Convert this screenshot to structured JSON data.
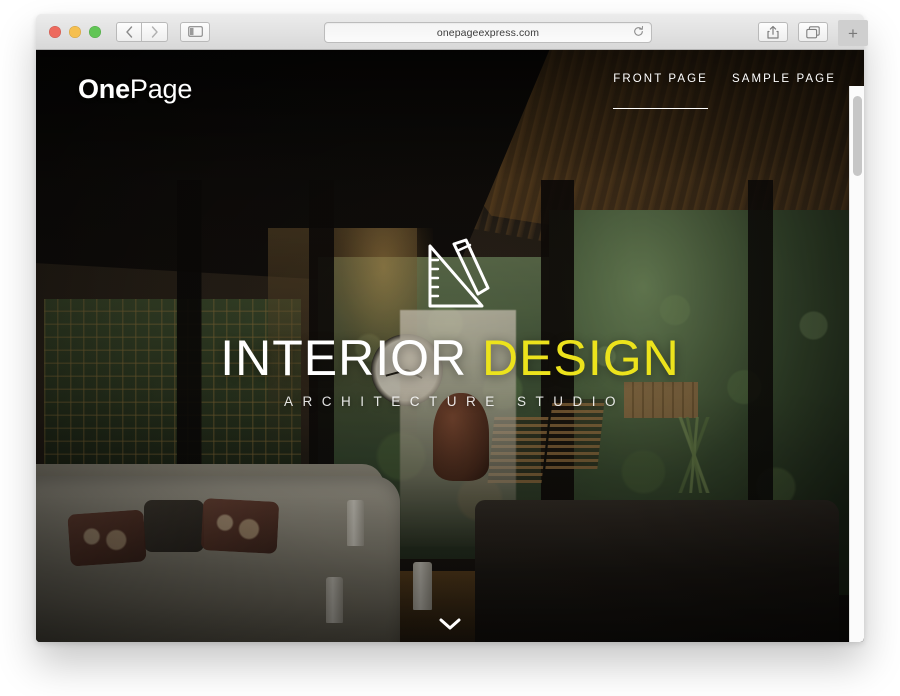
{
  "browser": {
    "traffic_lights": [
      {
        "name": "close",
        "color": "#ED6A5E"
      },
      {
        "name": "minimize",
        "color": "#F5BF4F"
      },
      {
        "name": "zoom",
        "color": "#61C555"
      }
    ],
    "back_label": "‹",
    "forward_label": "›",
    "sidebar_label": "sidebar-toggle",
    "url": "onepageexpress.com",
    "reload_label": "reload",
    "share_label": "share",
    "tabs_label": "show-all-tabs",
    "new_tab_label": "+"
  },
  "site": {
    "logo": {
      "bold_part": "One",
      "light_part": "Page"
    },
    "nav": [
      {
        "label": "FRONT PAGE",
        "active": true
      },
      {
        "label": "SAMPLE PAGE",
        "active": false
      }
    ],
    "hero": {
      "icon_name": "set-square-and-pencil-icon",
      "title_white": "INTERIOR",
      "title_yellow": "DESIGN",
      "subtitle": "ARCHITECTURE STUDIO",
      "scroll_cue_name": "chevron-down-icon",
      "accent_color": "#ECE31C",
      "text_color": "#FFFFFF"
    }
  },
  "scrollbar": {
    "position_label": "top"
  }
}
